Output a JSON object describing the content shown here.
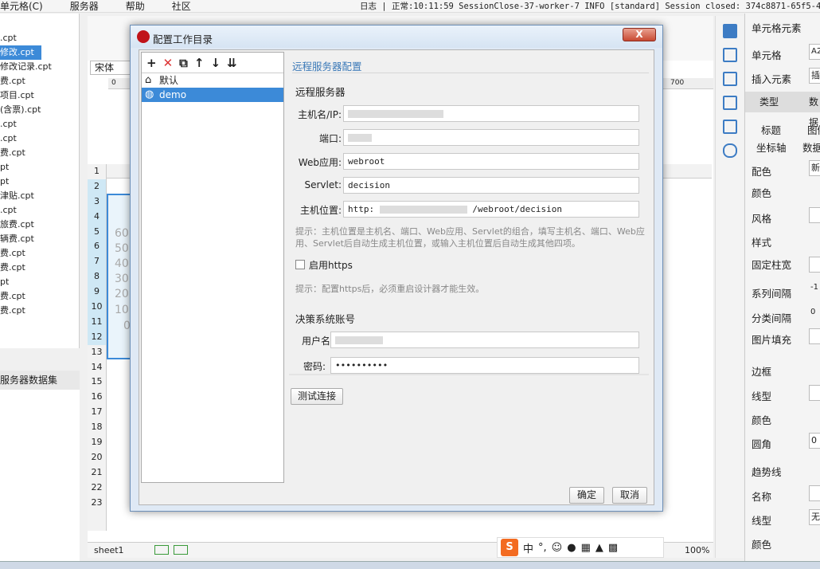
{
  "menu": {
    "items": [
      "单元格(C)",
      "服务器",
      "帮助",
      "社区"
    ],
    "log": "日志 | 正常:10:11:59 SessionClose-37-worker-7 INFO [standard] Session closed: 374c8871-65f5-4cea"
  },
  "left_files": [
    ".cpt",
    "修改.cpt",
    "修改记录.cpt",
    "费.cpt",
    "项目.cpt",
    "(含票).cpt",
    ".cpt",
    ".cpt",
    "费.cpt",
    "pt",
    "pt",
    "津贴.cpt",
    ".cpt",
    "旅费.cpt",
    "辆费.cpt",
    "费.cpt",
    "费.cpt",
    "pt",
    "费.cpt",
    "费.cpt"
  ],
  "left_section": "服务器数据集",
  "font_name": "宋体",
  "ruler": {
    "start": "0",
    "end": "700"
  },
  "rows": [
    "1",
    "2",
    "3",
    "4",
    "5",
    "6",
    "7",
    "8",
    "9",
    "10",
    "11",
    "12",
    "13",
    "14",
    "15",
    "16",
    "17",
    "18",
    "19",
    "20",
    "21",
    "22",
    "23"
  ],
  "chart_ticks": [
    "60",
    "50",
    "40",
    "30",
    "20",
    "10",
    "0"
  ],
  "sheet_tab": "sheet1",
  "zoom": "100%",
  "right_panel": {
    "title": "单元格元素",
    "cell_label": "单元格",
    "cell_value": "A2",
    "insert_label": "插入元素",
    "insert_value": "插",
    "tabs": [
      "类型",
      "数据"
    ],
    "subtabs": [
      "标题",
      "图例",
      "坐标轴",
      "数据"
    ],
    "props": [
      "配色",
      "颜色",
      "风格",
      "样式",
      "固定柱宽",
      "系列间隔",
      "分类间隔",
      "图片填充",
      "边框",
      "线型",
      "颜色",
      "圆角",
      "趋势线",
      "名称",
      "线型",
      "颜色"
    ],
    "values": {
      "color_scheme": "新",
      "series_gap": "-1",
      "cat_gap": "0",
      "radius": "0",
      "line_type": "无"
    }
  },
  "ime": {
    "lang": "中",
    "punct": "°,"
  },
  "dialog": {
    "title": "配置工作目录",
    "close": "X",
    "tree": [
      {
        "label": "默认",
        "icon": "house-icon"
      },
      {
        "label": "demo",
        "icon": "globe-icon"
      }
    ],
    "form_title": "远程服务器配置",
    "section_remote": "远程服务器",
    "labels": {
      "host": "主机名/IP:",
      "port": "端口:",
      "webapp": "Web应用:",
      "servlet": "Servlet:",
      "location": "主机位置:",
      "user": "用户名:",
      "password": "密码:"
    },
    "values": {
      "webapp": "webroot",
      "servlet": "decision",
      "location_prefix": "http:",
      "location_suffix": "/webroot/decision",
      "password": "••••••••••"
    },
    "hint1": "提示：主机位置是主机名、端口、Web应用、Servlet的组合，填写主机名、端口、Web应用、Servlet后自动生成主机位置，或输入主机位置后自动生成其他四项。",
    "https_label": "启用https",
    "hint2": "提示：配置https后，必须重启设计器才能生效。",
    "section_account": "决策系统账号",
    "test_button": "测试连接",
    "ok": "确定",
    "cancel": "取消"
  }
}
